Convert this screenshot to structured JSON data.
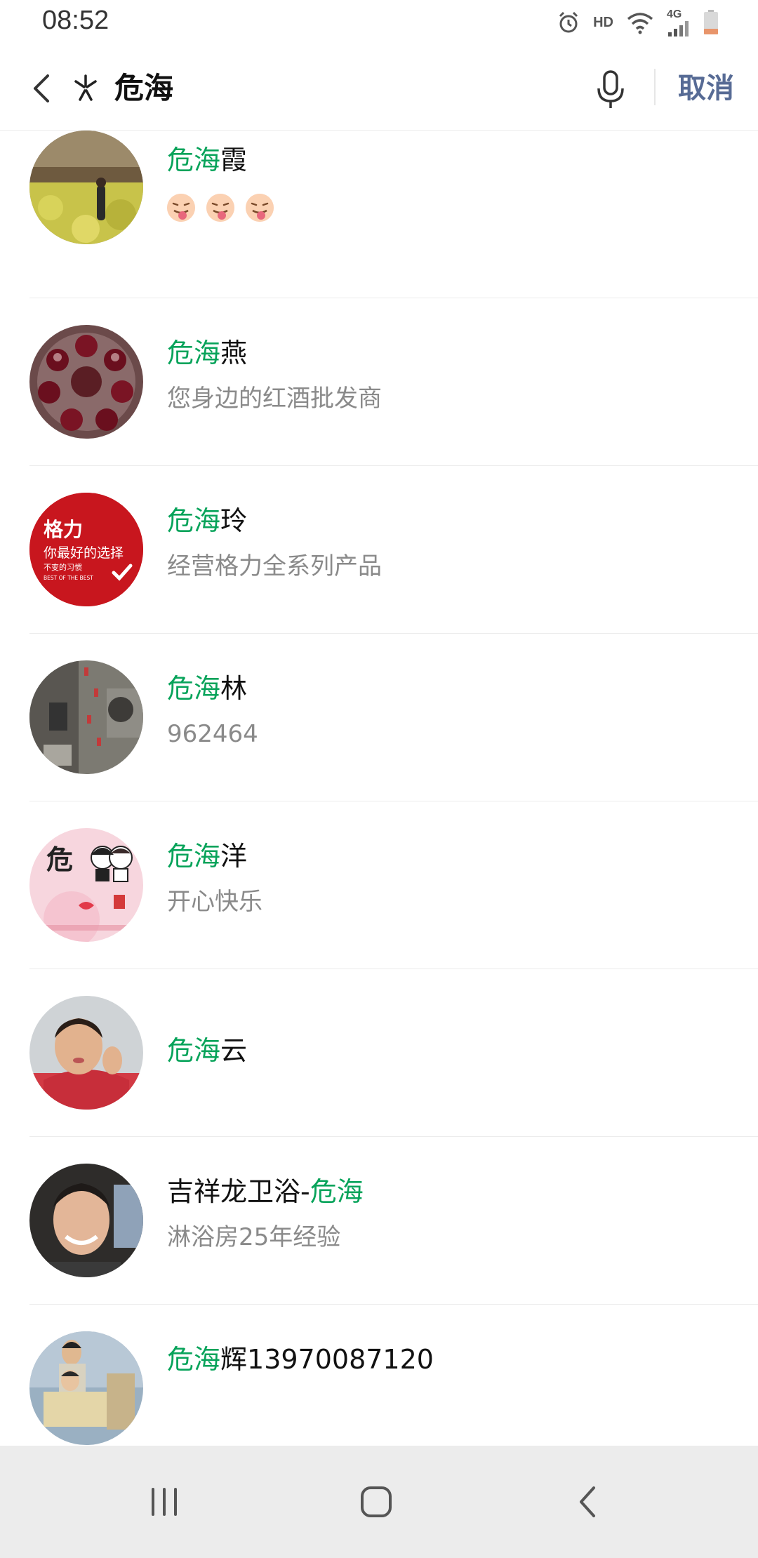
{
  "status_bar": {
    "time": "08:52",
    "hd": "HD",
    "network": "4G",
    "icons": [
      "alarm-icon",
      "wifi-icon",
      "cell-signal-icon",
      "battery-icon"
    ]
  },
  "search": {
    "query": "危海",
    "cancel_label": "取消",
    "icons": [
      "back-arrow-icon",
      "search-icon",
      "microphone-icon"
    ]
  },
  "colors": {
    "highlight": "#07a35a",
    "cancel": "#576b95",
    "subtitle": "#8a8a8a"
  },
  "results": [
    {
      "prefix": "",
      "match": "危海",
      "suffix": "霞",
      "subtitle": "",
      "emoji": [
        "tongue-out-face-icon",
        "tongue-out-face-icon",
        "tongue-out-face-icon"
      ],
      "avatar": "avatar-field-photo"
    },
    {
      "prefix": "",
      "match": "危海",
      "suffix": "燕",
      "subtitle": "您身边的红酒批发商",
      "avatar": "avatar-wine-glasses"
    },
    {
      "prefix": "",
      "match": "危海",
      "suffix": "玲",
      "subtitle": "经营格力全系列产品",
      "avatar": "avatar-gree-logo",
      "avatar_text": {
        "brand": "格力",
        "slogan": "你最好的选择",
        "sub": "不变的习惯",
        "en": "BEST OF THE BEST"
      }
    },
    {
      "prefix": "",
      "match": "危海",
      "suffix": "林",
      "subtitle": "962464",
      "avatar": "avatar-street-photo"
    },
    {
      "prefix": "",
      "match": "危海",
      "suffix": "洋",
      "subtitle": "开心快乐",
      "avatar": "avatar-couple-cartoon",
      "avatar_text": {
        "char": "危"
      }
    },
    {
      "prefix": "",
      "match": "危海",
      "suffix": "云",
      "subtitle": "",
      "avatar": "avatar-selfie"
    },
    {
      "prefix": "吉祥龙卫浴-",
      "match": "危海",
      "suffix": "",
      "subtitle": "淋浴房25年经验",
      "avatar": "avatar-man-portrait"
    },
    {
      "prefix": "",
      "match": "危海",
      "suffix": "辉13970087120",
      "subtitle": "",
      "avatar": "avatar-family-photo"
    }
  ],
  "nav_bar": {
    "buttons": [
      "recent-apps-icon",
      "home-icon",
      "back-icon"
    ]
  }
}
